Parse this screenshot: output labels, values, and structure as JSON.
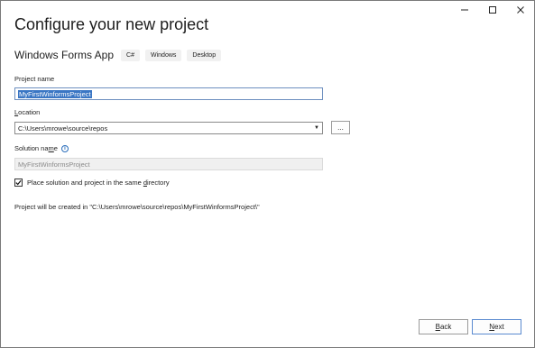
{
  "window": {
    "title": "Configure your new project",
    "caption": {
      "minimize_icon": "minimize-icon",
      "maximize_icon": "maximize-icon",
      "close_icon": "close-icon"
    }
  },
  "template": {
    "name": "Windows Forms App",
    "tags": [
      "C#",
      "Windows",
      "Desktop"
    ]
  },
  "project_name": {
    "label": "Project name",
    "value": "MyFirstWinformsProject"
  },
  "location": {
    "label_before": "",
    "label_underlined": "L",
    "label_after": "ocation",
    "value": "C:\\Users\\mrowe\\source\\repos",
    "browse_label": "..."
  },
  "solution_name": {
    "label_before": "Solution na",
    "label_underlined": "m",
    "label_after": "e",
    "value": "MyFirstWinformsProject",
    "info_icon": "info-icon"
  },
  "same_directory": {
    "checked": true,
    "label_before": "Place solution and project in the same ",
    "label_underlined": "d",
    "label_after": "irectory"
  },
  "path_note": "Project will be created in \"C:\\Users\\mrowe\\source\\repos\\MyFirstWinformsProject\\\"",
  "footer": {
    "back_before": "",
    "back_underlined": "B",
    "back_after": "ack",
    "next_before": "",
    "next_underlined": "N",
    "next_after": "ext"
  },
  "colors": {
    "accent": "#3a76c4",
    "focus_border": "#6d8fbf",
    "info": "#2a6ebb"
  }
}
